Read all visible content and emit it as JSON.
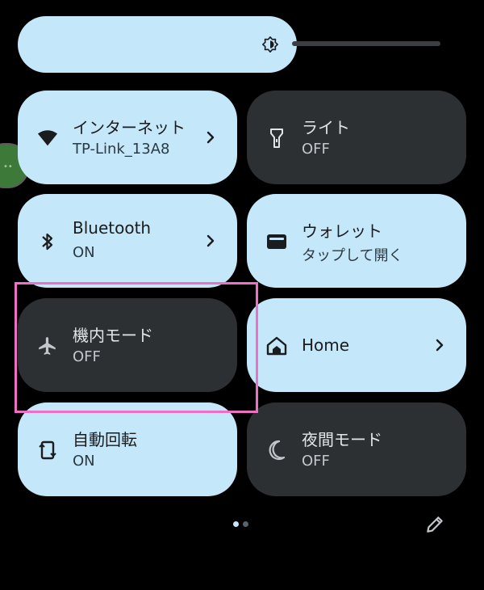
{
  "brightness": {
    "level": 0.57,
    "icon": "brightness-icon"
  },
  "tiles": [
    {
      "key": "internet",
      "title": "インターネット",
      "subtitle": "TP-Link_13A8",
      "state": "on",
      "icon": "wifi-icon",
      "chevron": true
    },
    {
      "key": "flashlight",
      "title": "ライト",
      "subtitle": "OFF",
      "state": "off",
      "icon": "flashlight-icon",
      "chevron": false
    },
    {
      "key": "bluetooth",
      "title": "Bluetooth",
      "subtitle": "ON",
      "state": "on",
      "icon": "bluetooth-icon",
      "chevron": true
    },
    {
      "key": "wallet",
      "title": "ウォレット",
      "subtitle": "タップして開く",
      "state": "on",
      "icon": "wallet-icon",
      "chevron": false
    },
    {
      "key": "airplane",
      "title": "機内モード",
      "subtitle": "OFF",
      "state": "off",
      "icon": "airplane-icon",
      "chevron": false
    },
    {
      "key": "home",
      "title": "Home",
      "subtitle": "",
      "state": "on",
      "icon": "home-icon",
      "chevron": true
    },
    {
      "key": "autorotate",
      "title": "自動回転",
      "subtitle": "ON",
      "state": "on",
      "icon": "rotate-icon",
      "chevron": false
    },
    {
      "key": "nightmode",
      "title": "夜間モード",
      "subtitle": "OFF",
      "state": "off",
      "icon": "moon-icon",
      "chevron": false
    }
  ],
  "pager": {
    "pages": 2,
    "current": 1
  },
  "colors": {
    "tile_on": "#c4e7fa",
    "tile_off": "#2d3033",
    "highlight": "#f06fc6",
    "background": "#000000"
  }
}
